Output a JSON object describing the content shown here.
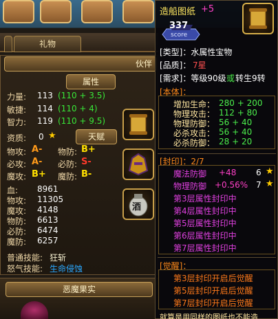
{
  "left": {
    "tabs": [
      "礼物",
      "伙伴"
    ],
    "attr_header": "属性",
    "talent_header": "天赋",
    "stats": [
      {
        "label": "力量:",
        "value": "113",
        "bonus": "(110 + 3.5)"
      },
      {
        "label": "敏捷:",
        "value": "114",
        "bonus": "(110 + 4)"
      },
      {
        "label": "智力:",
        "value": "119",
        "bonus": "(110 + 9.5)"
      }
    ],
    "aptitude": {
      "label": "资质:",
      "value": "0"
    },
    "grades": [
      {
        "label": "物攻:",
        "grade": "A-",
        "label2": "物防:",
        "grade2": "B+"
      },
      {
        "label": "必攻:",
        "grade": "A-",
        "label2": "必防:",
        "grade2": "S-"
      },
      {
        "label": "魔攻:",
        "grade": "B+",
        "label2": "魔防:",
        "grade2": "B-"
      }
    ],
    "combat": [
      {
        "label": "血:",
        "value": "8961"
      },
      {
        "label": "物攻:",
        "value": "11305"
      },
      {
        "label": "魔攻:",
        "value": "4148"
      },
      {
        "label": "物防:",
        "value": "6613"
      },
      {
        "label": "必防:",
        "value": "6474"
      },
      {
        "label": "魔防:",
        "value": "6257"
      }
    ],
    "normal_skill": {
      "label": "普通技能:",
      "value": "狂斩"
    },
    "rage_skill": {
      "label": "怒气技能:",
      "value": "生命侵蚀"
    },
    "devil_fruit": "恶魔果实",
    "wine_label": "酒"
  },
  "tooltip": {
    "title": "造船图纸",
    "plus": "+5",
    "score_value": "337",
    "score_label": "score",
    "type_line": "[类型]：水属性宝物",
    "quality_label": "[品质]：",
    "quality_value": "7星",
    "require_label": "[需求]：等级90级",
    "require_or": "或",
    "require_tail": "转生9转",
    "base_header": "[本体]：",
    "base_stats": [
      {
        "label": "增加生命：",
        "value": "280 + 200"
      },
      {
        "label": "物理攻击：",
        "value": "112 + 80"
      },
      {
        "label": "物理防御：",
        "value": "56 + 40"
      },
      {
        "label": "必杀攻击：",
        "value": "56 + 40"
      },
      {
        "label": "必杀防御：",
        "value": "28 + 20"
      }
    ],
    "seal_header": "[封印]：2/7",
    "seals": [
      {
        "label": "魔法防御",
        "value": "+48",
        "stars": "6"
      },
      {
        "label": "物理防御",
        "value": "+0.56%",
        "stars": "7"
      }
    ],
    "sealed_lines": [
      "第3层属性封印中",
      "第4层属性封印中",
      "第5层属性封印中",
      "第6层属性封印中",
      "第7层属性封印中"
    ],
    "awaken_header": "[觉醒]：",
    "awaken_lines": [
      "第3层封印开启后觉醒",
      "第5层封印开启后觉醒",
      "第7层封印开启后觉醒"
    ],
    "footer": "就算是用同样的图纸也不能造"
  },
  "colors": {
    "accent_green": "#38e838",
    "seal_pink": "#ff40c8",
    "section_orange": "#ff8a1a"
  }
}
